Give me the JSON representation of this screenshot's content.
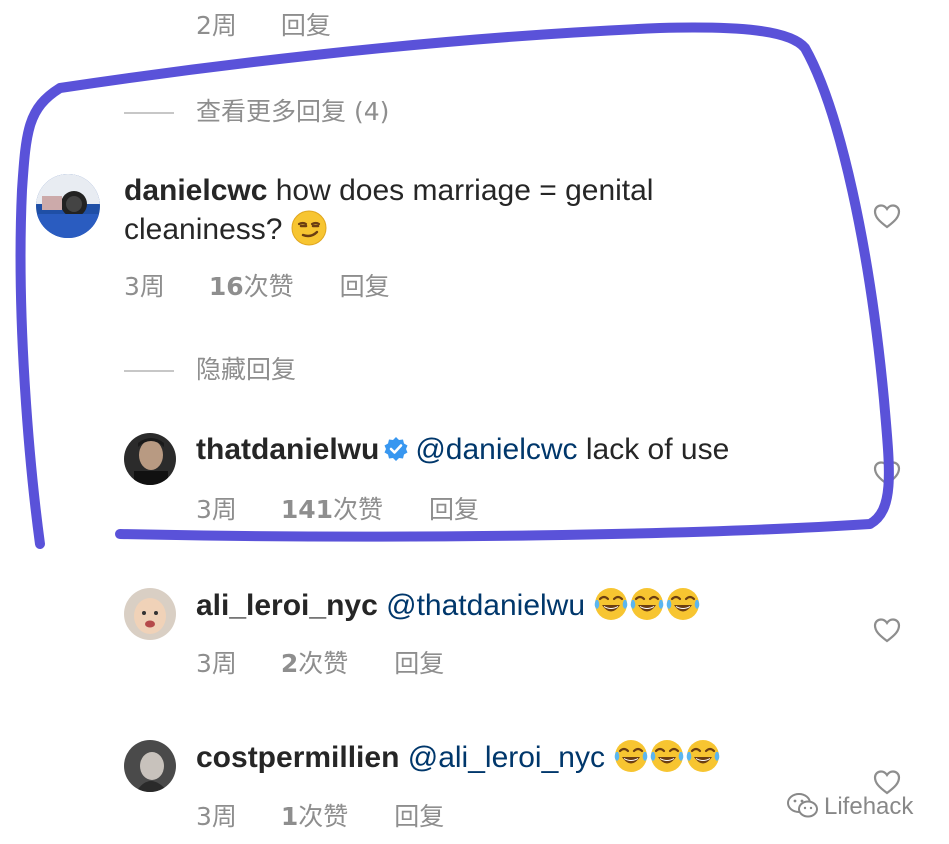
{
  "top_meta": {
    "time": "2周",
    "reply": "回复"
  },
  "view_more": {
    "label": "查看更多回复 (4)"
  },
  "comments": [
    {
      "user": "danielcwc",
      "text_line1": "how does marriage = genital",
      "text_line2": "cleaniness?",
      "time": "3周",
      "likes": "16",
      "likes_suffix": "次赞",
      "reply": "回复"
    },
    {
      "user": "thatdanielwu",
      "mention": "@danielcwc",
      "text": "lack of use",
      "time": "3周",
      "likes": "141",
      "likes_suffix": "次赞",
      "reply": "回复"
    },
    {
      "user": "ali_leroi_nyc",
      "mention": "@thatdanielwu",
      "time": "3周",
      "likes": "2",
      "likes_suffix": "次赞",
      "reply": "回复"
    },
    {
      "user": "costpermillien",
      "mention": "@ali_leroi_nyc",
      "time": "3周",
      "likes": "1",
      "likes_suffix": "次赞",
      "reply": "回复"
    }
  ],
  "hide_replies": {
    "label": "隐藏回复"
  },
  "watermark": {
    "text": "Lifehack"
  },
  "colors": {
    "highlight_stroke": "#5a52d9",
    "meta_text": "#8e8e8e",
    "mention": "#00376b",
    "verified": "#3897f0"
  },
  "icons": [
    "heart-icon",
    "verified-badge-icon",
    "smirk-emoji-icon",
    "tears-of-joy-emoji-icon",
    "wechat-logo-icon"
  ]
}
